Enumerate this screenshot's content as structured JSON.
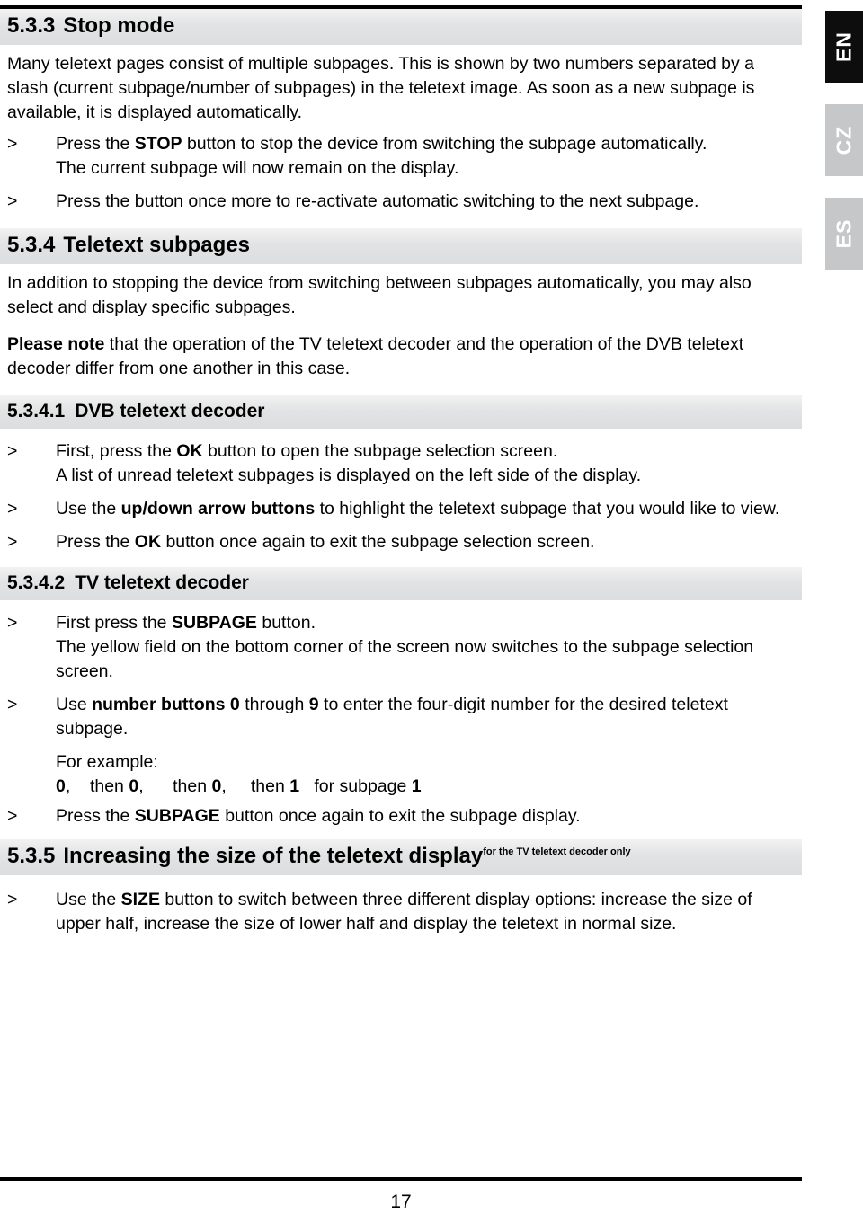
{
  "document": {
    "page_number": "17",
    "language_tabs": [
      {
        "label": "EN",
        "active": true
      },
      {
        "label": "CZ",
        "active": false
      },
      {
        "label": "ES",
        "active": false
      }
    ]
  },
  "sections": {
    "s533": {
      "number": "5.3.3",
      "title": "Stop mode",
      "intro": "Many teletext pages consist of multiple subpages. This is shown by two numbers separated by a slash (current subpage/number of subpages) in the teletext image. As soon as a new subpage is available, it is displayed automatically.",
      "bullet1_marker": ">",
      "bullet1_pre": "Press the ",
      "bullet1_kbd": "STOP",
      "bullet1_post": " button to stop the device from switching the subpage automatically.",
      "bullet1_line2": "The current subpage will now remain on the display.",
      "bullet2_marker": ">",
      "bullet2_text": "Press the button once more to re-activate automatic switching to the next subpage."
    },
    "s534": {
      "number": "5.3.4",
      "title": "Teletext subpages",
      "para1": "In addition to stopping the device from switching between subpages automatically, you may also select and display specific subpages.",
      "para2_bold": "Please note",
      "para2_rest": " that the operation of the TV teletext decoder and the operation of the DVB teletext decoder differ from one another in this case."
    },
    "s5341": {
      "number": "5.3.4.1",
      "title": "DVB teletext decoder",
      "bullet1_marker": ">",
      "bullet1_pre": "First, press the ",
      "bullet1_kbd": "OK",
      "bullet1_post": " button to open the subpage selection screen.",
      "bullet1_line2": "A list of unread teletext subpages is displayed on the left side of the display.",
      "bullet2_marker": ">",
      "bullet2_pre": "Use the ",
      "bullet2_kbd": "up/down arrow buttons",
      "bullet2_post": " to highlight the teletext subpage that you would like to view.",
      "bullet3_marker": ">",
      "bullet3_pre": "Press the ",
      "bullet3_kbd": "OK",
      "bullet3_post": " button once again to exit the subpage selection screen."
    },
    "s5342": {
      "number": "5.3.4.2",
      "title": "TV teletext decoder",
      "bullet1_marker": ">",
      "bullet1_pre": "First press the ",
      "bullet1_kbd": "SUBPAGE",
      "bullet1_post": " button.",
      "bullet1_line2": "The yellow field on the bottom corner of the screen now switches to the subpage selection screen.",
      "bullet2_marker": ">",
      "bullet2_pre": "Use ",
      "bullet2_kbd1": "number buttons 0",
      "bullet2_mid": " through ",
      "bullet2_kbd2": "9",
      "bullet2_post": " to enter the four-digit number for the desired teletext subpage.",
      "example_label": "For example:",
      "example_d1": "0",
      "example_sep1": ",    then ",
      "example_d2": "0",
      "example_sep2": ",      then ",
      "example_d3": "0",
      "example_sep3": ",     then ",
      "example_d4": "1",
      "example_tail": "   for subpage ",
      "example_result": "1",
      "bullet3_marker": ">",
      "bullet3_pre": "Press the ",
      "bullet3_kbd": "SUBPAGE",
      "bullet3_post": " button once again to exit the subpage display."
    },
    "s535": {
      "number": "5.3.5",
      "title": "Increasing the size of the teletext display",
      "superscript": "for the TV teletext decoder only",
      "bullet1_marker": ">",
      "bullet1_pre": "Use the ",
      "bullet1_kbd": "SIZE",
      "bullet1_post": " button to switch between three different display options: increase the size of upper half, increase the size of lower half and display the teletext in normal size."
    }
  }
}
